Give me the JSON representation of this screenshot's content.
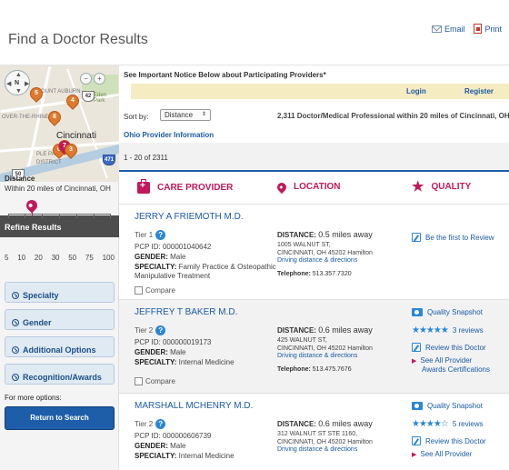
{
  "header": {
    "title": "Find a Doctor Results",
    "email_label": "Email",
    "print_label": "Print"
  },
  "map": {
    "labels": [
      "MOUNT AUBURN",
      "Eden Park",
      "OVER-THE-RHINE",
      "Cincinnati",
      "PLE PAR",
      "DISTRICT"
    ],
    "pins": [
      "5",
      "4",
      "8",
      "6",
      "7",
      "3"
    ],
    "shields": [
      "42",
      "471",
      "50"
    ],
    "compass": "N",
    "zoom_in": "+",
    "zoom_out": "−"
  },
  "sidebar": {
    "refine_title": "Refine Results",
    "distance_label": "Distance",
    "distance_value": "Within 20 miles of Cincinnati, OH",
    "distance_selected_miles": 20,
    "ticks": [
      "5",
      "10",
      "20",
      "30",
      "50",
      "75",
      "100"
    ],
    "filters": [
      "Specialty",
      "Gender",
      "Additional Options",
      "Recognition/Awards"
    ],
    "more_options": "For more options:",
    "return_button": "Return to Search"
  },
  "main": {
    "notice": "See Important Notice Below about Participating Providers*",
    "login": "Login",
    "register": "Register",
    "sort_label": "Sort by:",
    "sort_value": "Distance",
    "result_count": "2,311 Doctor/Medical Professional within 20 miles of Cincinnati, OH",
    "ohio_link": "Ohio Provider Information",
    "page_range": "1 - 20 of 2311",
    "col_provider": "CARE PROVIDER",
    "col_location": "LOCATION",
    "col_quality": "QUALITY"
  },
  "providers": [
    {
      "name": "JERRY A FRIEMOTH M.D.",
      "tier": "Tier 1",
      "pcp": "PCP ID: 000001040642",
      "gender_label": "GENDER:",
      "gender": "Male",
      "specialty_label": "SPECIALTY:",
      "specialty": "Family Practice & Osteopathic Manipulative Treatment",
      "compare": "Compare",
      "distance_label": "DISTANCE:",
      "distance": "0.5 miles away",
      "address1": "1005 WALNUT ST,",
      "address2": "CINCINNATI, OH 45202 Hamilton",
      "directions": "Driving distance & directions",
      "tel_label": "Telephone:",
      "telephone": "513.357.7320",
      "review_link": "Be the first to Review"
    },
    {
      "name": "JEFFREY T BAKER M.D.",
      "tier": "Tier 2",
      "pcp": "PCP ID: 000000019173",
      "gender_label": "GENDER:",
      "gender": "Male",
      "specialty_label": "SPECIALTY:",
      "specialty": "Internal Medicine",
      "compare": "Compare",
      "distance_label": "DISTANCE:",
      "distance": "0.6 miles away",
      "address1": "425 WALNUT ST,",
      "address2": "CINCINNATI, OH 45202 Hamilton",
      "directions": "Driving distance & directions",
      "tel_label": "Telephone:",
      "telephone": "513.475.7676",
      "snapshot": "Quality Snapshot",
      "rating": 5,
      "reviews": "3 reviews",
      "review_link": "Review this Doctor",
      "awards1": "See All Provider",
      "awards2": "Awards Certifications"
    },
    {
      "name": "MARSHALL MCHENRY M.D.",
      "tier": "Tier 2",
      "pcp": "PCP ID: 000000606739",
      "gender_label": "GENDER:",
      "gender": "Male",
      "specialty_label": "SPECIALTY:",
      "specialty": "Internal Medicine",
      "distance_label": "DISTANCE:",
      "distance": "0.6 miles away",
      "address1": "312 WALNUT ST STE 1160,",
      "address2": "CINCINNATI, OH 45202 Hamilton",
      "directions": "Driving distance & directions",
      "snapshot": "Quality Snapshot",
      "rating": 4.5,
      "reviews": "5 reviews",
      "review_link": "Review this Doctor",
      "awards1": "See All Provider"
    }
  ],
  "colors": {
    "accent": "#c2185b",
    "link": "#1a5aa6",
    "button": "#1e5ea8",
    "login_bar": "#f6ecc2"
  }
}
